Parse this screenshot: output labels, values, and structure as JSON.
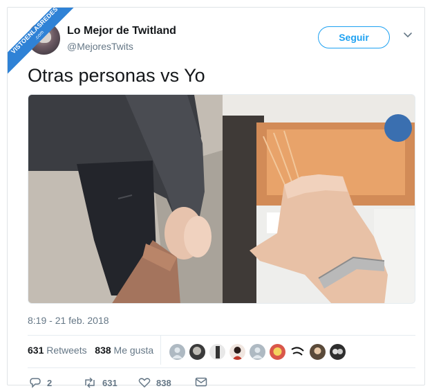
{
  "watermark": {
    "line1": "VISTOENLASREDES",
    "line2": ".com"
  },
  "header": {
    "display_name": "Lo Mejor de Twitland",
    "handle": "@MejoresTwits",
    "follow_label": "Seguir"
  },
  "tweet": {
    "text": "Otras personas vs Yo",
    "timestamp": "8:19 - 21 feb. 2018"
  },
  "stats": {
    "retweets_count": "631",
    "retweets_label": "Retweets",
    "likes_count": "838",
    "likes_label": "Me gusta"
  },
  "actions": {
    "reply_count": "2",
    "retweet_count": "631",
    "like_count": "838"
  },
  "colors": {
    "accent": "#1da1f2",
    "ribbon": "#2f82d6",
    "text_primary": "#14171a",
    "text_secondary": "#657786"
  },
  "likers": [
    {
      "icon": "default-avatar-icon"
    },
    {
      "icon": "user-avatar-icon"
    },
    {
      "icon": "user-avatar-icon"
    },
    {
      "icon": "user-avatar-icon"
    },
    {
      "icon": "default-avatar-icon"
    },
    {
      "icon": "user-avatar-icon"
    },
    {
      "icon": "user-avatar-icon"
    },
    {
      "icon": "user-avatar-icon"
    },
    {
      "icon": "user-avatar-icon"
    }
  ]
}
